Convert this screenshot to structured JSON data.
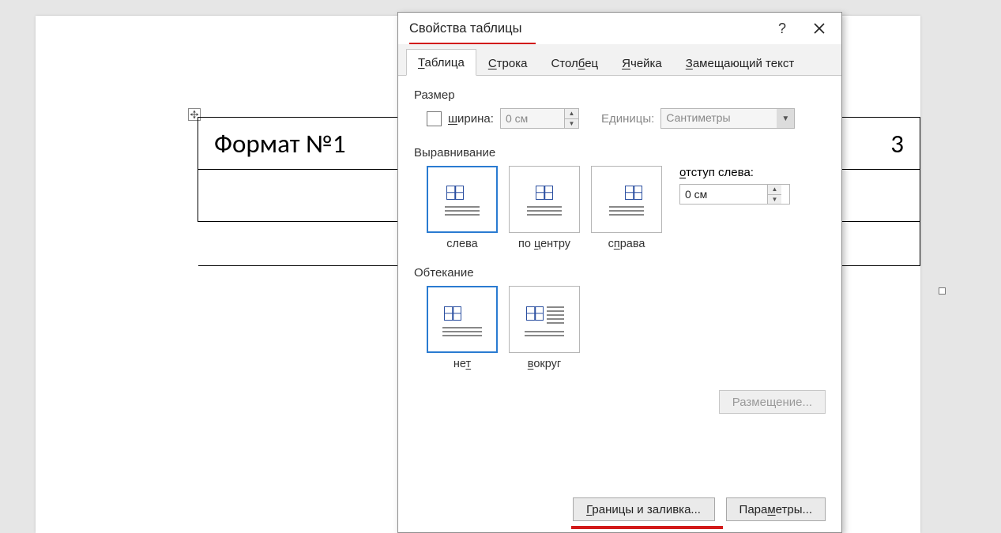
{
  "document": {
    "cell1": "Формат №1",
    "cell2_suffix": "3"
  },
  "dialog": {
    "title": "Свойства таблицы",
    "help": "?",
    "tabs": {
      "table": {
        "pre": "",
        "mn": "Т",
        "post": "аблица"
      },
      "row": {
        "pre": "",
        "mn": "С",
        "post": "трока"
      },
      "column": {
        "pre": "Стол",
        "mn": "б",
        "post": "ец"
      },
      "cell": {
        "pre": "",
        "mn": "Я",
        "post": "чейка"
      },
      "alttext": {
        "pre": "",
        "mn": "З",
        "post": "амещающий текст"
      }
    },
    "size": {
      "label": "Размер",
      "width_label": {
        "pre": "",
        "mn": "ш",
        "post": "ирина:"
      },
      "width_value": "0 см",
      "units_label": "Единицы:",
      "units_value": "Сантиметры"
    },
    "align": {
      "label": "Выравнивание",
      "left": {
        "pre": "слева",
        "mn": "",
        "post": ""
      },
      "center": {
        "pre": "по ",
        "mn": "ц",
        "post": "ентру"
      },
      "right": {
        "pre": "с",
        "mn": "п",
        "post": "рава"
      },
      "indent_label": {
        "pre": "",
        "mn": "о",
        "post": "тступ слева:"
      },
      "indent_value": "0 см"
    },
    "wrap": {
      "label": "Обтекание",
      "none": {
        "pre": "не",
        "mn": "т",
        "post": ""
      },
      "around": {
        "pre": "",
        "mn": "в",
        "post": "округ"
      }
    },
    "buttons": {
      "placement": "Размещение...",
      "borders": {
        "pre": "",
        "mn": "Г",
        "post": "раницы и заливка..."
      },
      "options": {
        "pre": "Пара",
        "mn": "м",
        "post": "етры..."
      }
    }
  }
}
